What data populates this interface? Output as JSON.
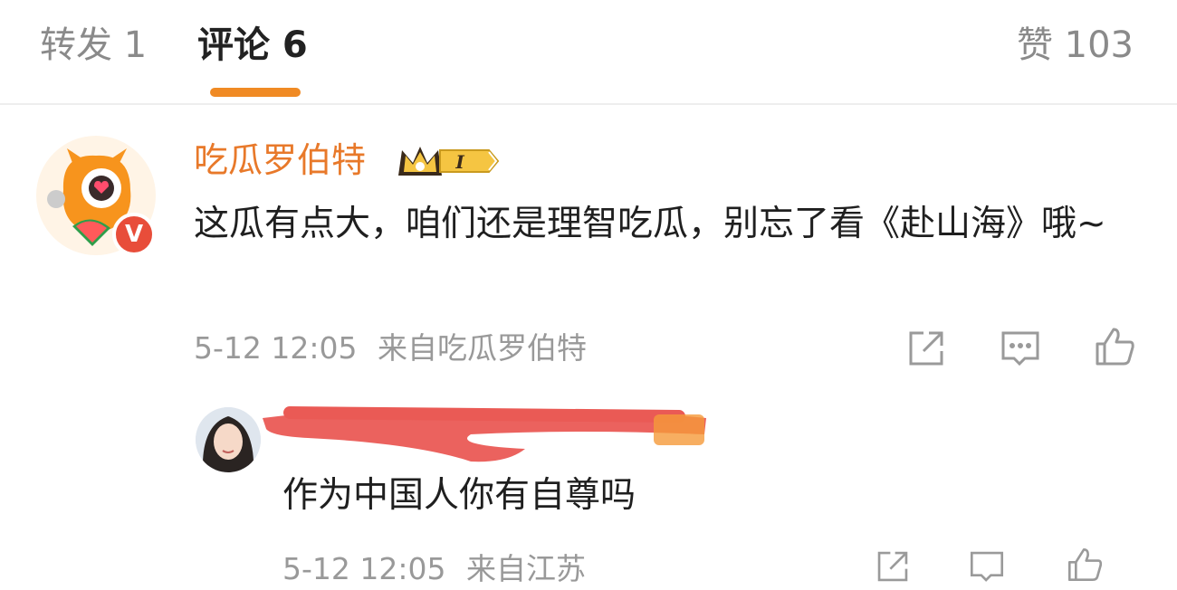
{
  "tabs": {
    "repost": "转发 1",
    "comments": "评论 6",
    "likes": "赞 103"
  },
  "colors": {
    "accent": "#f08a24",
    "username": "#e8792a",
    "verified": "#e84d3a",
    "muted": "#999999",
    "redaction": "#ea5a55"
  },
  "comments": [
    {
      "username": "吃瓜罗伯特",
      "member_level": "I",
      "verified_mark": "V",
      "text": "这瓜有点大，咱们还是理智吃瓜，别忘了看《赴山海》哦~",
      "time": "5-12 12:05",
      "source": "来自吃瓜罗伯特",
      "icons": [
        "share-icon",
        "reply-icon",
        "like-icon"
      ]
    }
  ],
  "reply": {
    "username_redacted": true,
    "text": "作为中国人你有自尊吗",
    "time": "5-12 12:05",
    "source": "来自江苏",
    "icons": [
      "share-icon",
      "reply-icon",
      "like-icon"
    ]
  }
}
